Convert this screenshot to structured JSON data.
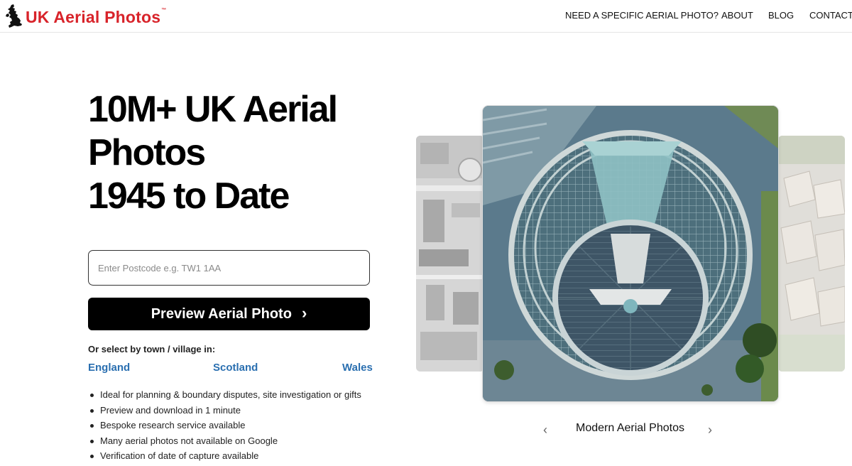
{
  "brand": {
    "name": "UK Aerial Photos",
    "tm": "™",
    "color": "#d8232a",
    "logo_icon": "uk-map-silhouette-icon"
  },
  "nav": {
    "items": [
      {
        "label": "NEED A SPECIFIC AERIAL PHOTO?"
      },
      {
        "label": "ABOUT"
      },
      {
        "label": "BLOG"
      },
      {
        "label": "CONTACT"
      }
    ]
  },
  "hero": {
    "title_lines": [
      "10M+ UK Aerial",
      "Photos",
      "1945 to Date"
    ]
  },
  "search": {
    "placeholder": "Enter Postcode e.g. TW1 1AA",
    "value": "",
    "button_label": "Preview Aerial Photo",
    "button_icon": "chevron-right-icon"
  },
  "regions": {
    "label": "Or select by town / village in:",
    "items": [
      "England",
      "Scotland",
      "Wales"
    ],
    "link_color": "#2a6fb0"
  },
  "features": [
    "Ideal for planning & boundary disputes, site investigation or gifts",
    "Preview and download in 1 minute",
    "Bespoke research service available",
    "Many aerial photos not available on Google",
    "Verification of date of capture available"
  ],
  "carousel": {
    "caption": "Modern Aerial Photos",
    "prev_icon": "chevron-left-icon",
    "next_icon": "chevron-right-icon",
    "prev_glyph": "‹",
    "next_glyph": "›"
  }
}
